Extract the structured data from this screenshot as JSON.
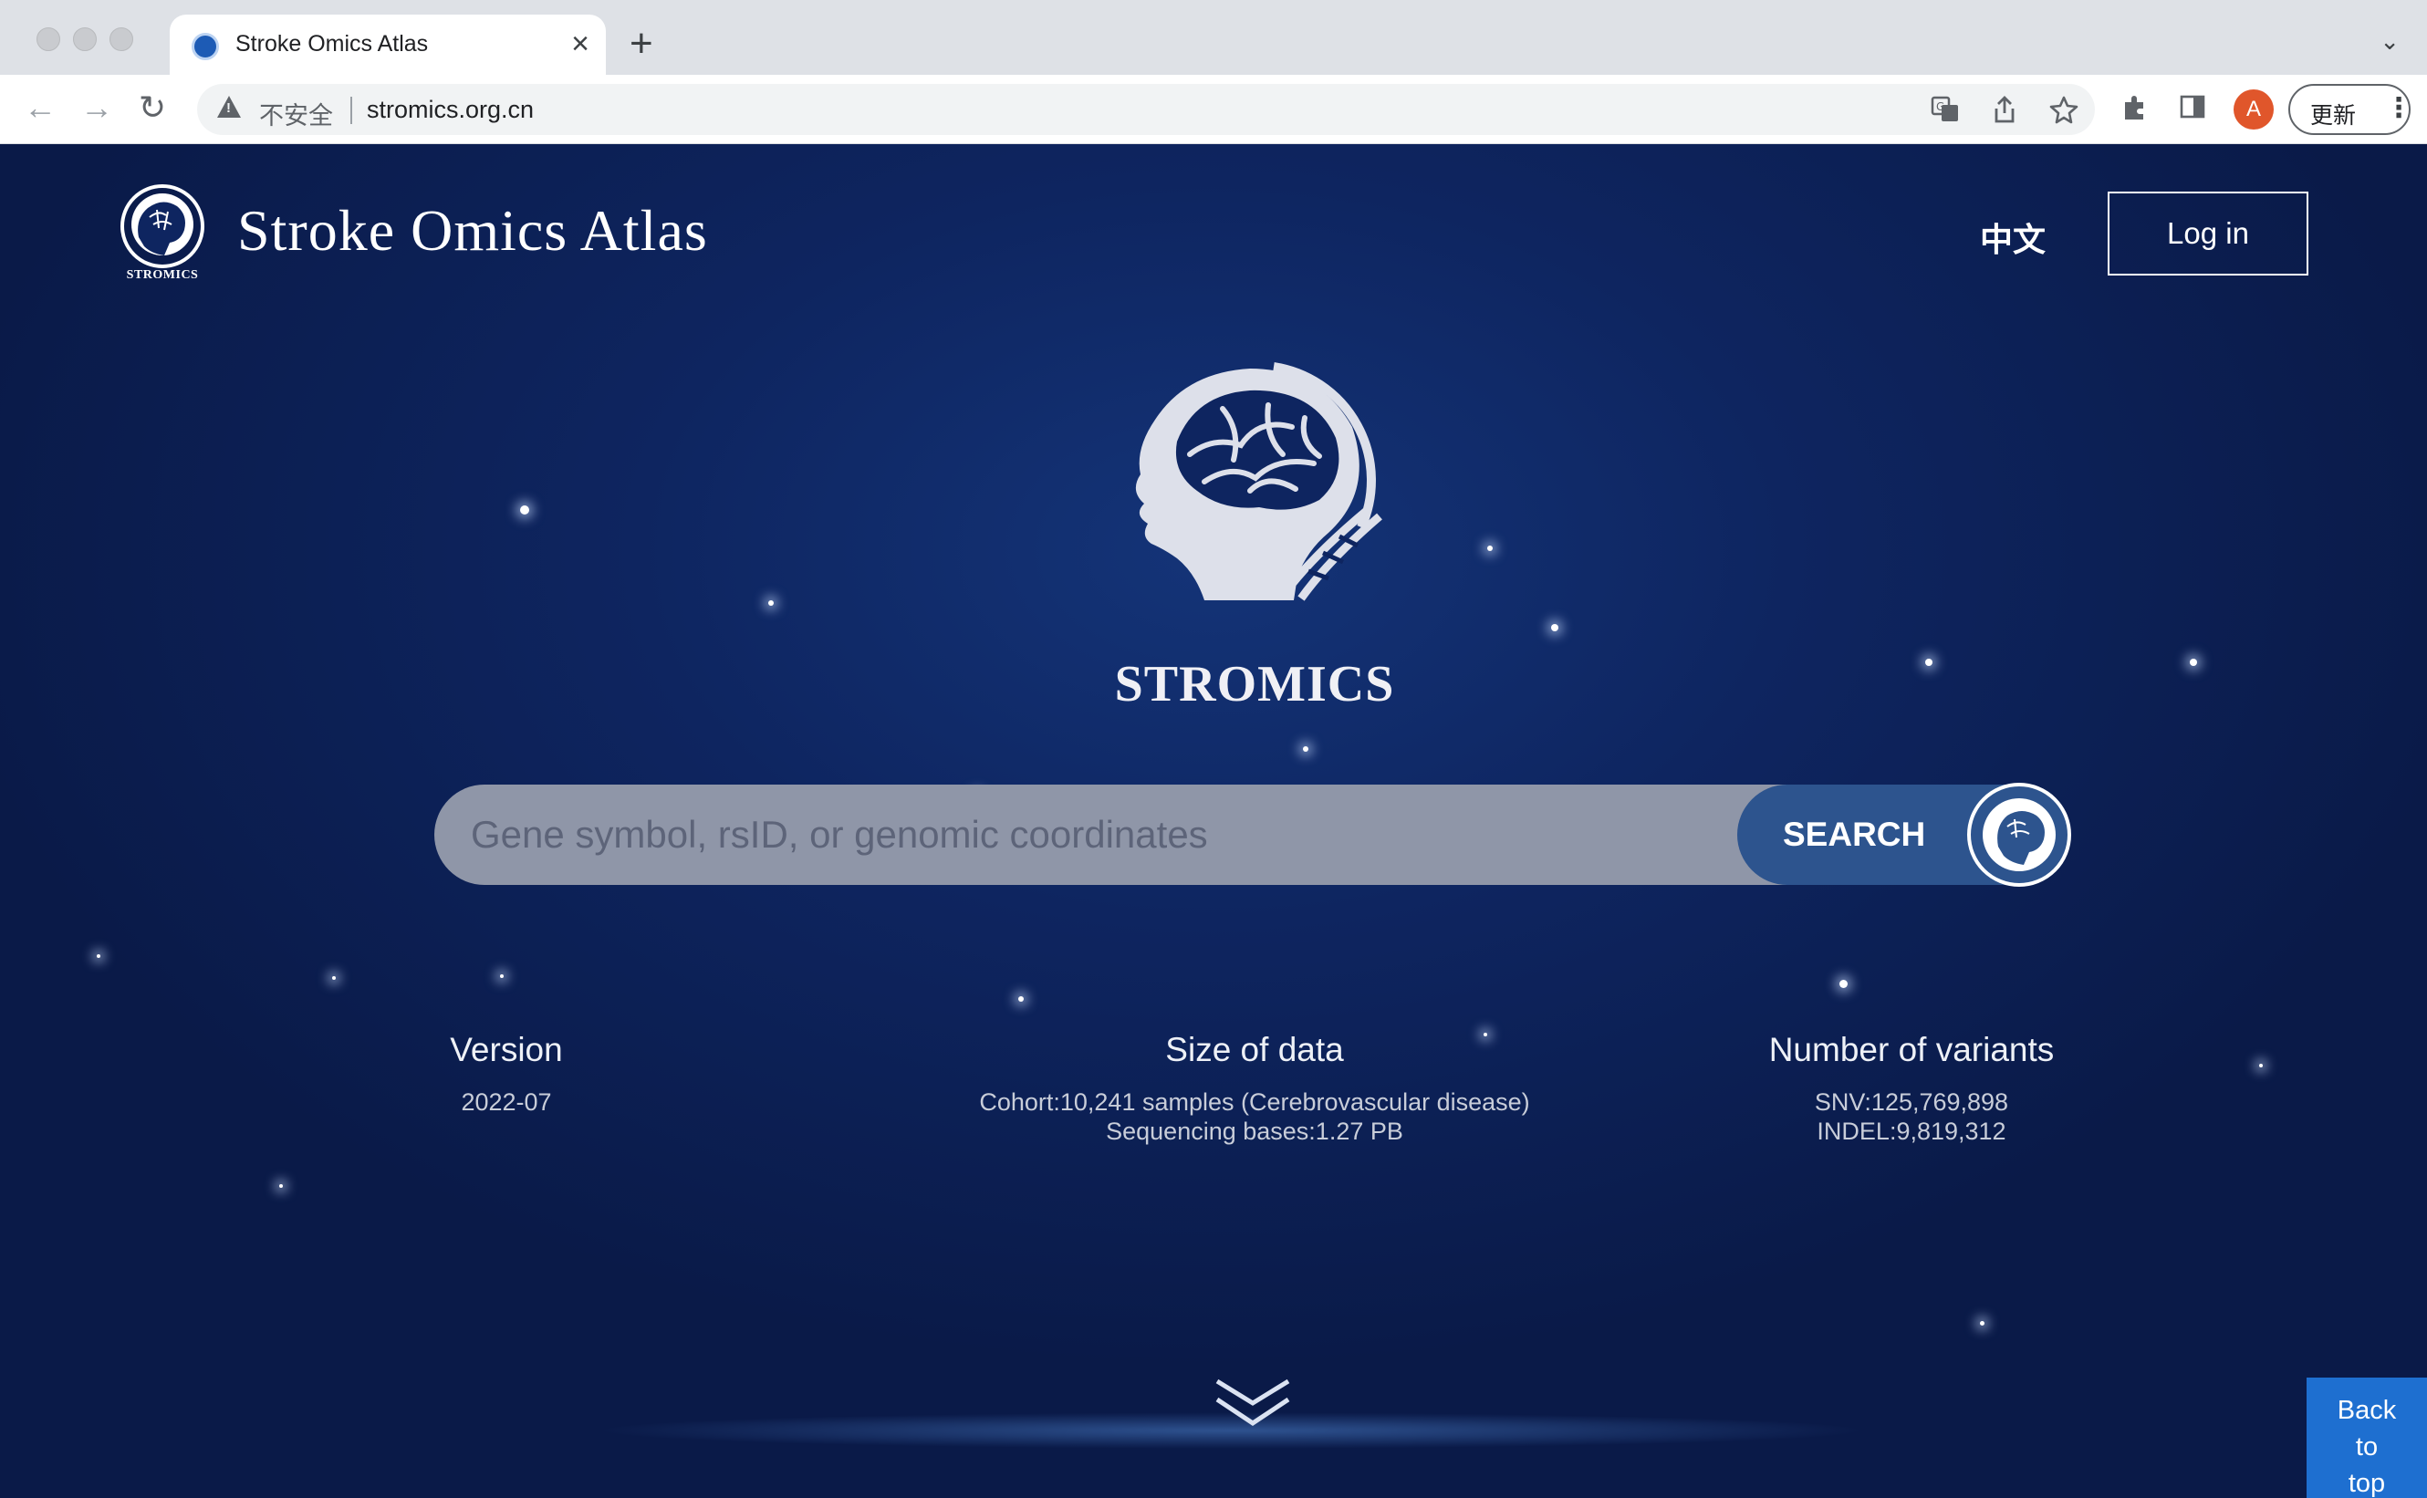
{
  "browser": {
    "tab_title": "Stroke Omics Atlas",
    "tab_close": "×",
    "new_tab": "+",
    "tab_dropdown": "⌄",
    "back": "←",
    "forward": "→",
    "reload": "↻",
    "security_label": "不安全",
    "url": "stromics.org.cn",
    "profile_initial": "A",
    "update_label": "更新",
    "menu": "⋮",
    "icons": [
      "translate-icon",
      "share-icon",
      "bookmark-star-icon",
      "extensions-icon",
      "side-panel-icon"
    ]
  },
  "header": {
    "logo_text": "STROMICS",
    "title": "Stroke Omics Atlas",
    "language_link": "中文",
    "login_label": "Log in"
  },
  "hero": {
    "name": "STROMICS"
  },
  "search": {
    "placeholder": "Gene symbol, rsID, or genomic coordinates",
    "button_label": "SEARCH"
  },
  "stats": {
    "version": {
      "heading": "Version",
      "lines": [
        "2022-07"
      ]
    },
    "size": {
      "heading": "Size of data",
      "lines": [
        "Cohort:10,241 samples (Cerebrovascular disease)",
        "Sequencing bases:1.27 PB"
      ]
    },
    "variants": {
      "heading": "Number of variants",
      "lines": [
        "SNV:125,769,898",
        "INDEL:9,819,312"
      ]
    }
  },
  "back_to_top": {
    "line1": "Back",
    "line2": "to",
    "line3": "top"
  },
  "colors": {
    "page_background": "#0e2560",
    "search_bar": "#8f96a8",
    "search_button": "#2d548e",
    "back_to_top": "#1e6fd0",
    "avatar": "#e0562b"
  }
}
